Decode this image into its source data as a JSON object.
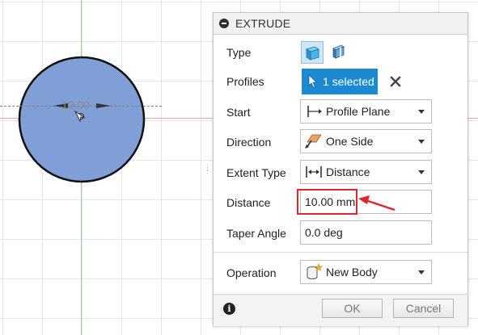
{
  "sketch": {
    "dimension_text": "10.00"
  },
  "panel": {
    "title": "EXTRUDE",
    "rows": {
      "type": {
        "label": "Type"
      },
      "profiles": {
        "label": "Profiles",
        "selected_text": "1 selected"
      },
      "start": {
        "label": "Start",
        "value": "Profile Plane"
      },
      "direction": {
        "label": "Direction",
        "value": "One Side"
      },
      "extent_type": {
        "label": "Extent Type",
        "value": "Distance"
      },
      "distance": {
        "label": "Distance",
        "value": "10.00 mm"
      },
      "taper_angle": {
        "label": "Taper Angle",
        "value": "0.0 deg"
      },
      "operation": {
        "label": "Operation",
        "value": "New Body"
      }
    },
    "footer": {
      "info_symbol": "i",
      "ok_label": "OK",
      "cancel_label": "Cancel"
    }
  },
  "colors": {
    "accent": "#1b8ad3",
    "sketch_fill": "#7f9fd6",
    "highlight": "#e0262c"
  },
  "icons": {
    "panel": "collapse-icon",
    "type_solid": "solid-extrude-icon",
    "type_thin": "thin-extrude-icon",
    "profiles": "cursor-icon",
    "profiles_clear": "close-icon",
    "start": "profile-plane-icon",
    "direction": "one-side-icon",
    "extent": "distance-icon",
    "operation": "new-body-icon",
    "info": "info-icon"
  }
}
